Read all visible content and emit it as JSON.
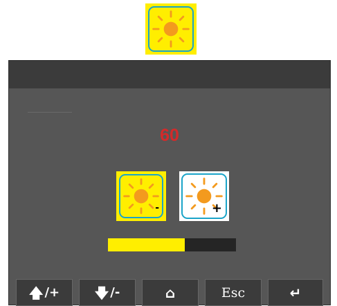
{
  "top_icon": {
    "name": "brightness-icon"
  },
  "panel": {
    "brightness_value": "60",
    "brightness_level_percent": 60,
    "decrease_button": {
      "icon": "sun-icon",
      "sign": "-"
    },
    "increase_button": {
      "icon": "sun-icon",
      "sign": "+"
    }
  },
  "softkeys": [
    {
      "glyph": "🡅",
      "symbol": "/+"
    },
    {
      "glyph": "🡇",
      "symbol": "/-"
    },
    {
      "glyph": "⌂",
      "symbol": ""
    },
    {
      "label": "Esc"
    },
    {
      "glyph": "↵",
      "symbol": ""
    }
  ],
  "colors": {
    "accent_yellow": "#ffee00",
    "sun_orange": "#f39a1e",
    "tile_border": "#1aa4c8",
    "value_red": "#d42a2a",
    "panel_bg": "#565656",
    "header_bg": "#3b3b3b"
  }
}
